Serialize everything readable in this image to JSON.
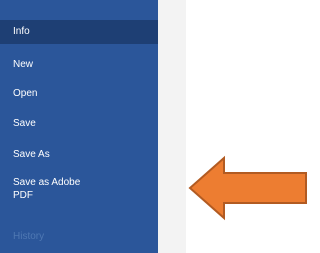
{
  "backstage": {
    "items": [
      {
        "label": "Info",
        "selected": true
      },
      {
        "label": "New"
      },
      {
        "label": "Open"
      },
      {
        "label": "Save"
      },
      {
        "label": "Save As"
      },
      {
        "label": "Save as Adobe\nPDF"
      },
      {
        "label": "History",
        "disabled": true
      }
    ]
  },
  "colors": {
    "nav_background": "#2b569a",
    "nav_selected": "#1e3f74",
    "panel_background": "#f3f3f3",
    "arrow_fill": "#ed7d31",
    "arrow_stroke": "#b25b22"
  },
  "annotation": {
    "icon": "left-arrow-icon"
  }
}
